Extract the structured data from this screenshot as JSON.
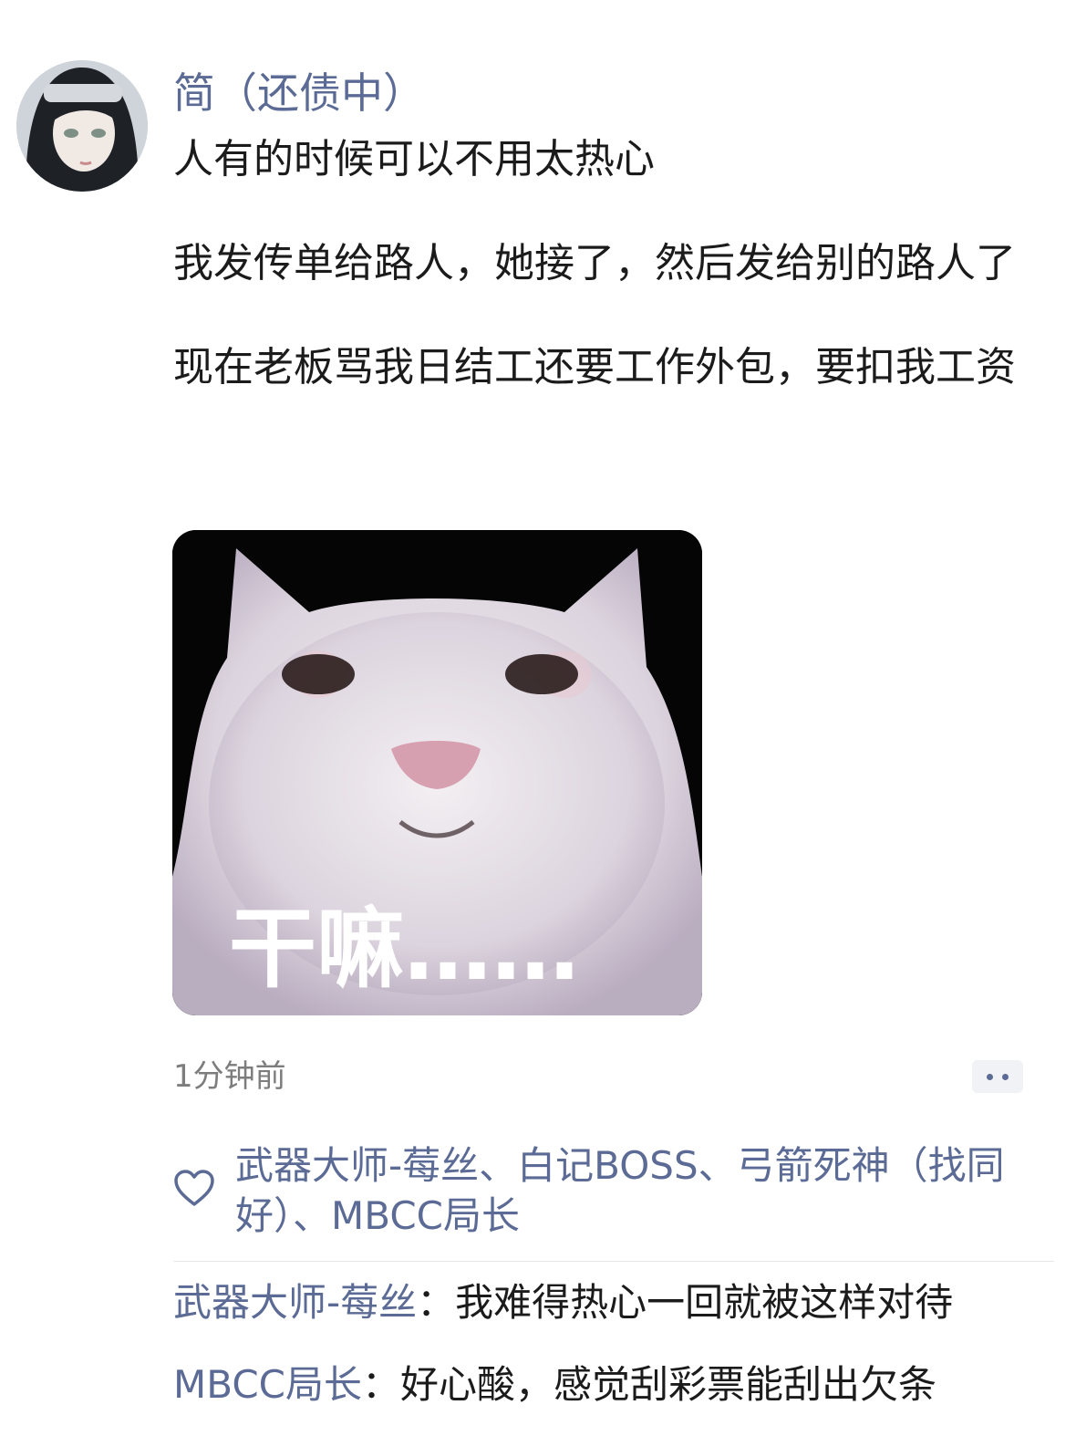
{
  "post": {
    "username": "简（还债中）",
    "lines": [
      "人有的时候可以不用太热心",
      "我发传单给路人，她接了，然后发给别的路人了",
      "现在老板骂我日结工还要工作外包，要扣我工资"
    ],
    "image_caption": "干嘛……",
    "timestamp": "1分钟前"
  },
  "likes": {
    "text": "武器大师-莓丝、白记BOSS、弓箭死神（找同好）、MBCC局长"
  },
  "comments": [
    {
      "author": "武器大师-莓丝",
      "separator": "：",
      "text": "我难得热心一回就被这样对待"
    },
    {
      "author": "MBCC局长",
      "separator": "：",
      "text": "好心酸，感觉刮彩票能刮出欠条"
    }
  ],
  "colors": {
    "accent": "#5b6b95",
    "text": "#1b1b1b",
    "muted": "#7d7d7d",
    "divider": "#e6e6e6"
  },
  "icons": {
    "like": "heart-icon",
    "more": "more-dots-icon"
  }
}
